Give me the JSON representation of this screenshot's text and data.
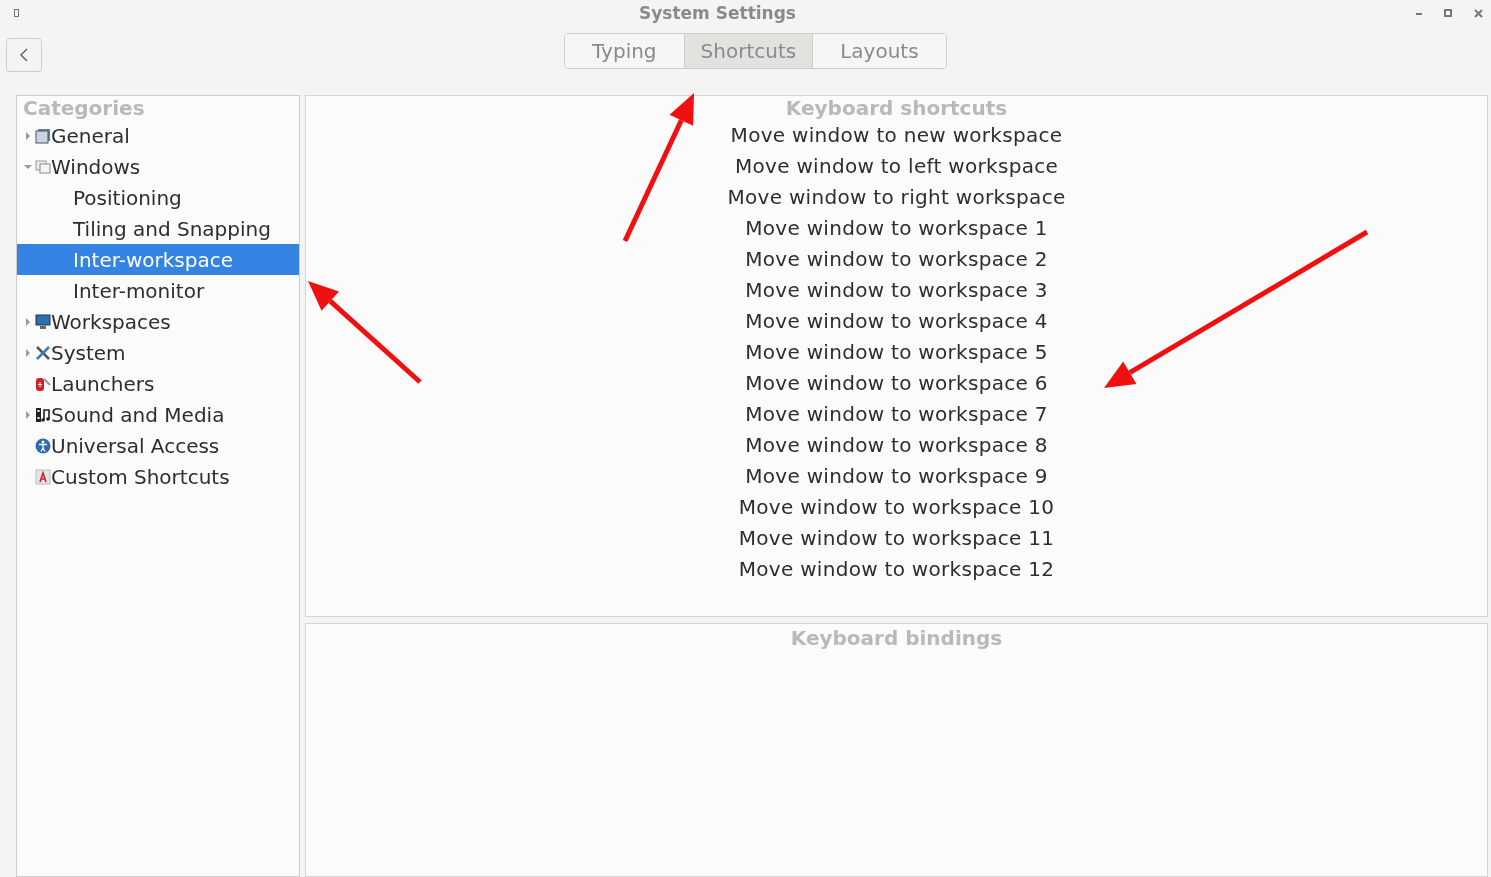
{
  "window": {
    "title": "System Settings"
  },
  "tabs": [
    {
      "label": "Typing",
      "selected": false
    },
    {
      "label": "Shortcuts",
      "selected": true
    },
    {
      "label": "Layouts",
      "selected": false
    }
  ],
  "categories": {
    "title": "Categories",
    "items": [
      {
        "label": "General",
        "kind": "group",
        "expanded": false,
        "selected": false
      },
      {
        "label": "Windows",
        "kind": "group",
        "expanded": true,
        "selected": false,
        "children": [
          {
            "label": "Positioning",
            "selected": false
          },
          {
            "label": "Tiling and Snapping",
            "selected": false
          },
          {
            "label": "Inter-workspace",
            "selected": true
          },
          {
            "label": "Inter-monitor",
            "selected": false
          }
        ]
      },
      {
        "label": "Workspaces",
        "kind": "group",
        "expanded": false,
        "selected": false
      },
      {
        "label": "System",
        "kind": "group",
        "expanded": false,
        "selected": false
      },
      {
        "label": "Launchers",
        "kind": "leaf",
        "selected": false
      },
      {
        "label": "Sound and Media",
        "kind": "group",
        "expanded": false,
        "selected": false
      },
      {
        "label": "Universal Access",
        "kind": "leaf",
        "selected": false
      },
      {
        "label": "Custom Shortcuts",
        "kind": "leaf",
        "selected": false
      }
    ]
  },
  "shortcuts": {
    "title": "Keyboard shortcuts",
    "items": [
      "Move window to new workspace",
      "Move window to left workspace",
      "Move window to right workspace",
      "Move window to workspace 1",
      "Move window to workspace 2",
      "Move window to workspace 3",
      "Move window to workspace 4",
      "Move window to workspace 5",
      "Move window to workspace 6",
      "Move window to workspace 7",
      "Move window to workspace 8",
      "Move window to workspace 9",
      "Move window to workspace 10",
      "Move window to workspace 11",
      "Move window to workspace 12"
    ]
  },
  "bindings": {
    "title": "Keyboard bindings"
  }
}
